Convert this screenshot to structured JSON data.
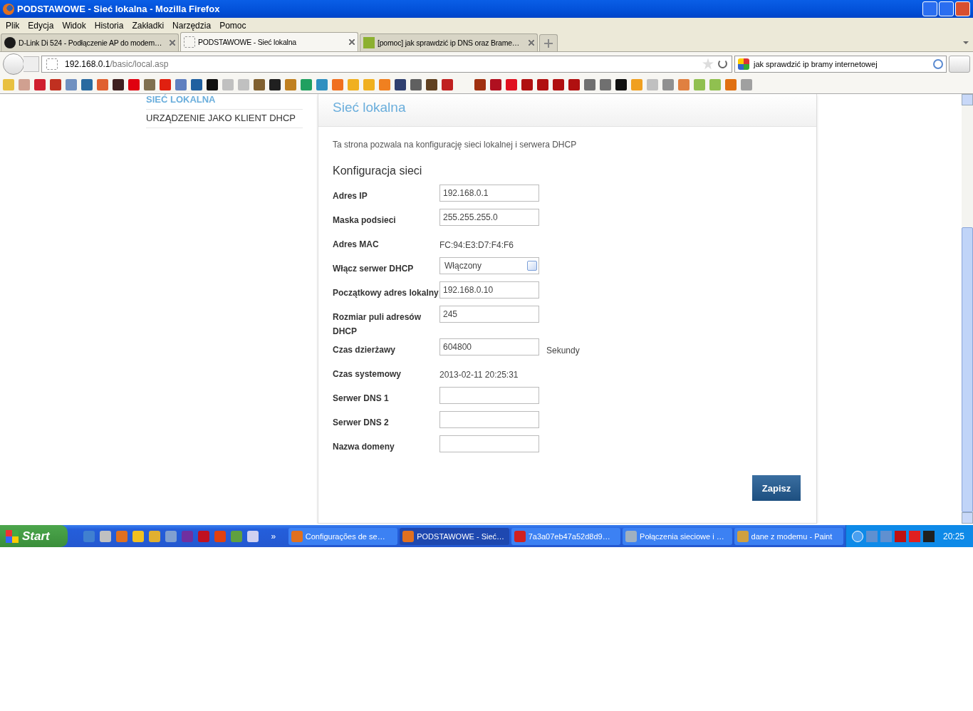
{
  "window": {
    "title": "PODSTAWOWE - Sieć lokalna - Mozilla Firefox"
  },
  "menu": [
    "Plik",
    "Edycja",
    "Widok",
    "Historia",
    "Zakładki",
    "Narzędzia",
    "Pomoc"
  ],
  "tabs": [
    {
      "label": "D-Link Di 524 - Podłączenie AP do modem…",
      "selected": false,
      "kind": "ie"
    },
    {
      "label": "PODSTAWOWE - Sieć lokalna",
      "selected": true,
      "kind": "blank"
    },
    {
      "label": "[pomoc] jak sprawdzić ip DNS oraz Brame…",
      "selected": false,
      "kind": "fp"
    }
  ],
  "address": {
    "host": "192.168.0.1",
    "path": "/basic/local.asp"
  },
  "search": {
    "value": "jak sprawdzić ip bramy internetowej"
  },
  "bookmarks": [
    {
      "color": "#e8c040"
    },
    {
      "color": "#d0a090"
    },
    {
      "color": "#d02030"
    },
    {
      "color": "#c03020"
    },
    {
      "color": "#7090c0"
    },
    {
      "color": "#2a6aa0"
    },
    {
      "color": "#e06030"
    },
    {
      "color": "#402020"
    },
    {
      "color": "#e00010"
    },
    {
      "color": "#807050"
    },
    {
      "color": "#e02010"
    },
    {
      "color": "#6080c0"
    },
    {
      "color": "#2060a0"
    },
    {
      "color": "#101010"
    },
    {
      "color": "#c0c0c0"
    },
    {
      "color": "#c0c0c0"
    },
    {
      "color": "#806030"
    },
    {
      "color": "#202020"
    },
    {
      "color": "#c08020"
    },
    {
      "color": "#20a060"
    },
    {
      "color": "#3090c0"
    },
    {
      "color": "#f07020"
    },
    {
      "color": "#f0b020"
    },
    {
      "color": "#f0b020"
    },
    {
      "color": "#f08020"
    },
    {
      "color": "#304070"
    },
    {
      "color": "#606060"
    },
    {
      "color": "#604020"
    },
    {
      "color": "#c02020"
    },
    {
      "color": "#a03010"
    },
    {
      "color": "#b01020"
    },
    {
      "color": "#e01020"
    },
    {
      "color": "#b01010"
    },
    {
      "color": "#b01010"
    },
    {
      "color": "#b01010"
    },
    {
      "color": "#b01010"
    },
    {
      "color": "#707070"
    },
    {
      "color": "#707070"
    },
    {
      "color": "#101010"
    },
    {
      "color": "#f0a020"
    },
    {
      "color": "#c0c0c0"
    },
    {
      "color": "#909090"
    },
    {
      "color": "#e08040"
    },
    {
      "color": "#90c050"
    },
    {
      "color": "#90c050"
    },
    {
      "color": "#e07010"
    },
    {
      "color": "#a0a0a0"
    }
  ],
  "sidebar": {
    "items": [
      {
        "label": "SIEĆ LOKALNA",
        "selected": true
      },
      {
        "label": "URZĄDZENIE JAKO KLIENT DHCP",
        "selected": false
      }
    ]
  },
  "panel": {
    "title": "Sieć lokalna",
    "description": "Ta strona pozwala na konfigurację sieci lokalnej i serwera DHCP",
    "section": "Konfiguracja sieci",
    "fields": [
      {
        "label": "Adres IP",
        "kind": "input",
        "value": "192.168.0.1"
      },
      {
        "label": "Maska podsieci",
        "kind": "input",
        "value": "255.255.255.0"
      },
      {
        "label": "Adres MAC",
        "kind": "text",
        "value": "FC:94:E3:D7:F4:F6"
      },
      {
        "label": "Włącz serwer DHCP",
        "kind": "select",
        "value": "Włączony"
      },
      {
        "label": "Początkowy adres lokalny",
        "kind": "input",
        "value": "192.168.0.10"
      },
      {
        "label": "Rozmiar puli adresów DHCP",
        "kind": "input",
        "value": "245"
      },
      {
        "label": "Czas dzierżawy",
        "kind": "input",
        "value": "604800",
        "unit": "Sekundy"
      },
      {
        "label": "Czas systemowy",
        "kind": "text",
        "value": "2013-02-11 20:25:31"
      },
      {
        "label": "Serwer DNS 1",
        "kind": "input"
      },
      {
        "label": "Serwer DNS 2",
        "kind": "input"
      },
      {
        "label": "Nazwa domeny",
        "kind": "input"
      }
    ],
    "save_button": "Zapisz"
  },
  "taskbar": {
    "start": "Start",
    "quick_launch": [
      {
        "color": "#4080d0"
      },
      {
        "color": "#c0c0c0"
      },
      {
        "color": "#e07020"
      },
      {
        "color": "#f0c020"
      },
      {
        "color": "#e0b030"
      },
      {
        "color": "#80a0d0"
      },
      {
        "color": "#7030a0"
      },
      {
        "color": "#c01020"
      },
      {
        "color": "#e04010"
      },
      {
        "color": "#60a040"
      },
      {
        "color": "#d0d0f0"
      }
    ],
    "overflow": "»",
    "items": [
      {
        "label": "Configurações de se…",
        "selected": false,
        "color": "#e07020"
      },
      {
        "label": "PODSTAWOWE - Sieć…",
        "selected": true,
        "color": "#e07020"
      },
      {
        "label": "7a3a07eb47a52d8d9…",
        "selected": false,
        "color": "#d02020"
      },
      {
        "label": "Połączenia sieciowe i …",
        "selected": false,
        "color": "#a0b0c0"
      },
      {
        "label": "dane z modemu - Paint",
        "selected": false,
        "color": "#d0a040"
      }
    ],
    "tray": [
      {
        "color": "#6090d0"
      },
      {
        "color": "#6090d0"
      },
      {
        "color": "#c01010"
      },
      {
        "color": "#e02020"
      },
      {
        "color": "#202020"
      }
    ],
    "clock": "20:25"
  }
}
